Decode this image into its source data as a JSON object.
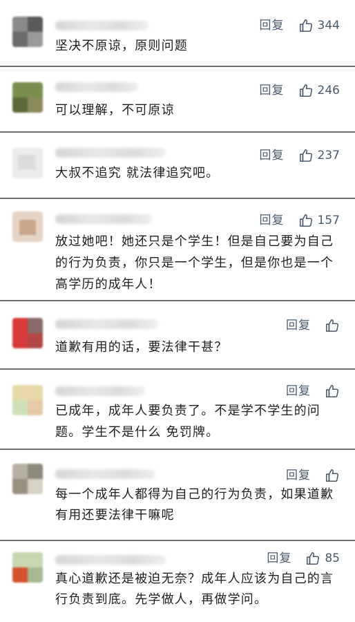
{
  "reply_label": "回复",
  "colors": {
    "action": "#4a5a6e",
    "divider": "#6e6e6e",
    "text": "#1e1e1e"
  },
  "like_icon": "thumbs-up-icon",
  "comments": [
    {
      "text": "坚决不原谅，原则问题",
      "likes": "344"
    },
    {
      "text": "可以理解，不可原谅",
      "likes": "246"
    },
    {
      "text": "大叔不追究 就法律追究吧。",
      "likes": "237"
    },
    {
      "text": "放过她吧！她还只是个学生！但是自己要为自己的行为负责，你只是一个学生，但是你也是一个高学历的成年人！",
      "likes": "157"
    },
    {
      "text": "道歉有用的话，要法律干甚？",
      "likes": ""
    },
    {
      "text": "已成年，成年人要负责了。不是学不学生的问题。学生不是什么 免罚牌。",
      "likes": ""
    },
    {
      "text": "每一个成年人都得为自己的行为负责，如果道歉有用还要法律干嘛呢",
      "likes": ""
    },
    {
      "text": "真心道歉还是被迫无奈？成年人应该为自己的言行负责到底。先学做人，再做学问。",
      "likes": "85"
    }
  ]
}
